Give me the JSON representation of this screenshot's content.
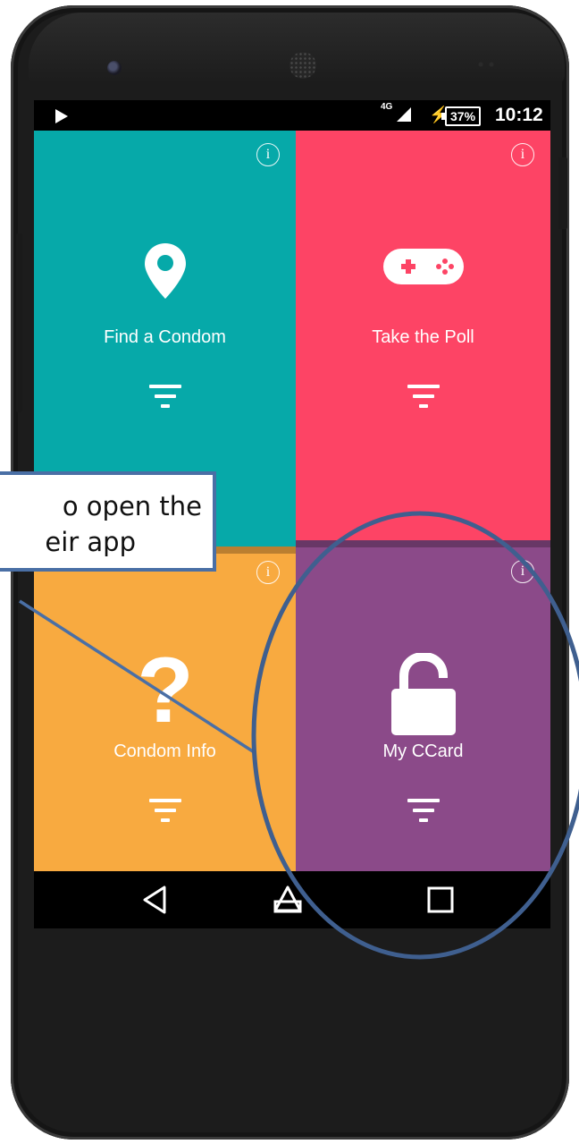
{
  "status_bar": {
    "network": "4G",
    "battery": "37%",
    "time": "10:12"
  },
  "tiles": [
    {
      "label": "Find a Condom",
      "icon": "map-pin-icon",
      "color": "#06a9a9"
    },
    {
      "label": "Take the Poll",
      "icon": "gamepad-icon",
      "color": "#fd4465"
    },
    {
      "label": "Condom Info",
      "icon": "question-mark-icon",
      "color": "#f8aa40"
    },
    {
      "label": "My CCard",
      "icon": "unlocked-padlock-icon",
      "color": "#8b4a89"
    }
  ],
  "info_icon_glyph": "i",
  "nav_bar": [
    "back-icon",
    "home-icon",
    "recents-icon"
  ],
  "annotation": {
    "line1": "o open the",
    "line2": "eir app",
    "color": "#4a6fa5"
  }
}
